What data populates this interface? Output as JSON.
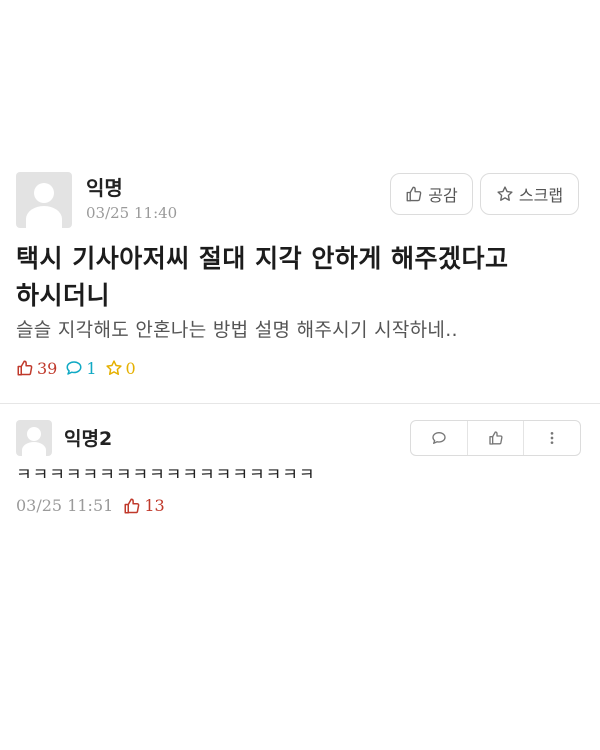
{
  "post": {
    "author": "익명",
    "time": "03/25 11:40",
    "title": "택시 기사아저씨 절대 지각 안하게 해주겠다고 하시더니",
    "body": "슬슬 지각해도 안혼나는 방법 설명 해주시기 시작하네..",
    "like_button": {
      "label": "공감",
      "icon": "thumbs-up-icon"
    },
    "scrap_button": {
      "label": "스크랩",
      "icon": "star-icon"
    },
    "stats": {
      "likes": "39",
      "comments": "1",
      "scraps": "0"
    }
  },
  "comment": {
    "author": "익명2",
    "text": "ㅋㅋㅋㅋㅋㅋㅋㅋㅋㅋㅋㅋㅋㅋㅋㅋㅋㅋ",
    "time": "03/25 11:51",
    "likes": "13",
    "actions": [
      "reply-icon",
      "thumbs-up-icon",
      "more-vertical-icon"
    ]
  },
  "colors": {
    "like": "#c0392b",
    "comment": "#10a9c4",
    "scrap": "#e5b000",
    "muted": "#9a9a9a"
  }
}
